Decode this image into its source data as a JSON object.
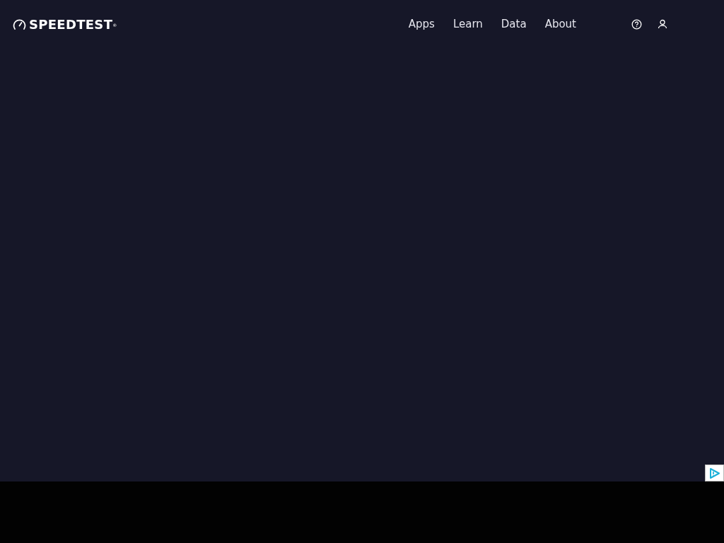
{
  "header": {
    "logo": "SPEEDTEST$^{®}$",
    "nav": [
      {
        "label": "Apps"
      },
      {
        "label": "Learn"
      },
      {
        "label": "Data"
      },
      {
        "label": "About"
      }
    ]
  }
}
